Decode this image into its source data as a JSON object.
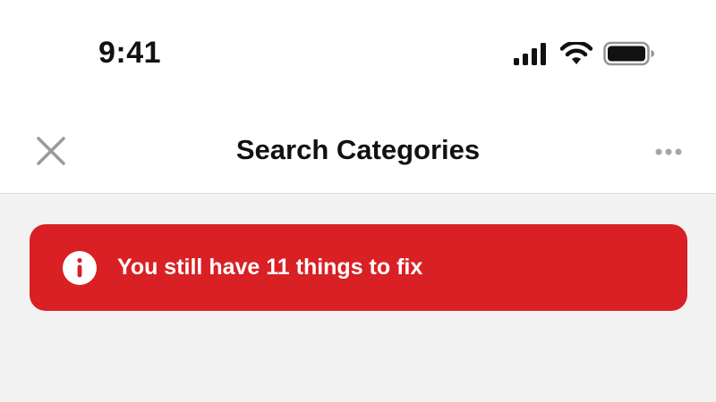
{
  "status_bar": {
    "time": "9:41",
    "icons": [
      "cellular-signal-icon",
      "wifi-icon",
      "battery-icon"
    ]
  },
  "header": {
    "title": "Search Categories",
    "close_icon": "close-icon",
    "more_icon": "more-horizontal-icon"
  },
  "banner": {
    "message": "You still have 11 things to fix",
    "icon": "info-icon",
    "color": "#d92024"
  },
  "colors": {
    "header_background": "#ffffff",
    "content_background": "#f2f2f2",
    "text_primary": "#111111",
    "icon_muted": "#9a9a9a"
  }
}
